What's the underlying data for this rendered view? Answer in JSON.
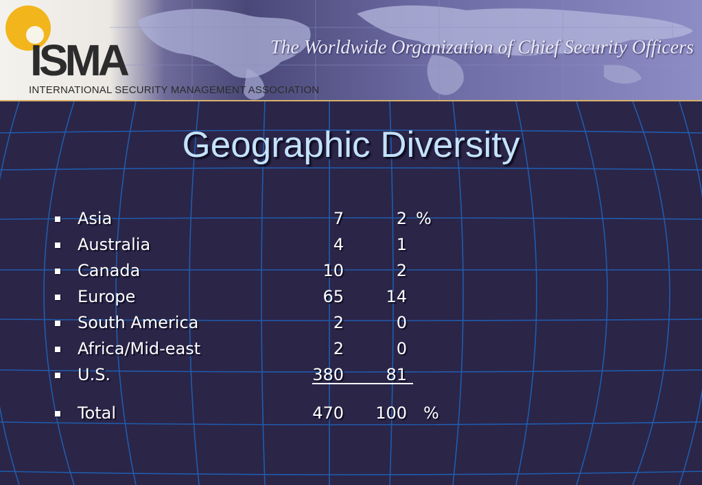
{
  "header": {
    "logo_text": "ISMA",
    "organization": "INTERNATIONAL SECURITY MANAGEMENT ASSOCIATION",
    "tagline": "The Worldwide Organization of Chief Security Officers"
  },
  "slide": {
    "title": "Geographic Diversity",
    "rows": [
      {
        "region": "Asia",
        "count": "7",
        "percent": "2",
        "unit": "%"
      },
      {
        "region": "Australia",
        "count": "4",
        "percent": "1",
        "unit": ""
      },
      {
        "region": "Canada",
        "count": "10",
        "percent": "2",
        "unit": ""
      },
      {
        "region": "Europe",
        "count": "65",
        "percent": "14",
        "unit": ""
      },
      {
        "region": "South America",
        "count": "2",
        "percent": "0",
        "unit": ""
      },
      {
        "region": "Africa/Mid-east",
        "count": "2",
        "percent": "0",
        "unit": ""
      },
      {
        "region": "U.S.",
        "count": "380",
        "percent": "81",
        "unit": ""
      }
    ],
    "total": {
      "region": "Total",
      "count": "470",
      "percent": "100",
      "unit": "%"
    }
  },
  "colors": {
    "background": "#2b2548",
    "grid_lines": "#1f63b8",
    "title": "#c4e2fb",
    "text": "#ffffff",
    "logo_sun": "#f2b51c",
    "header_rule": "#d9b26a"
  }
}
